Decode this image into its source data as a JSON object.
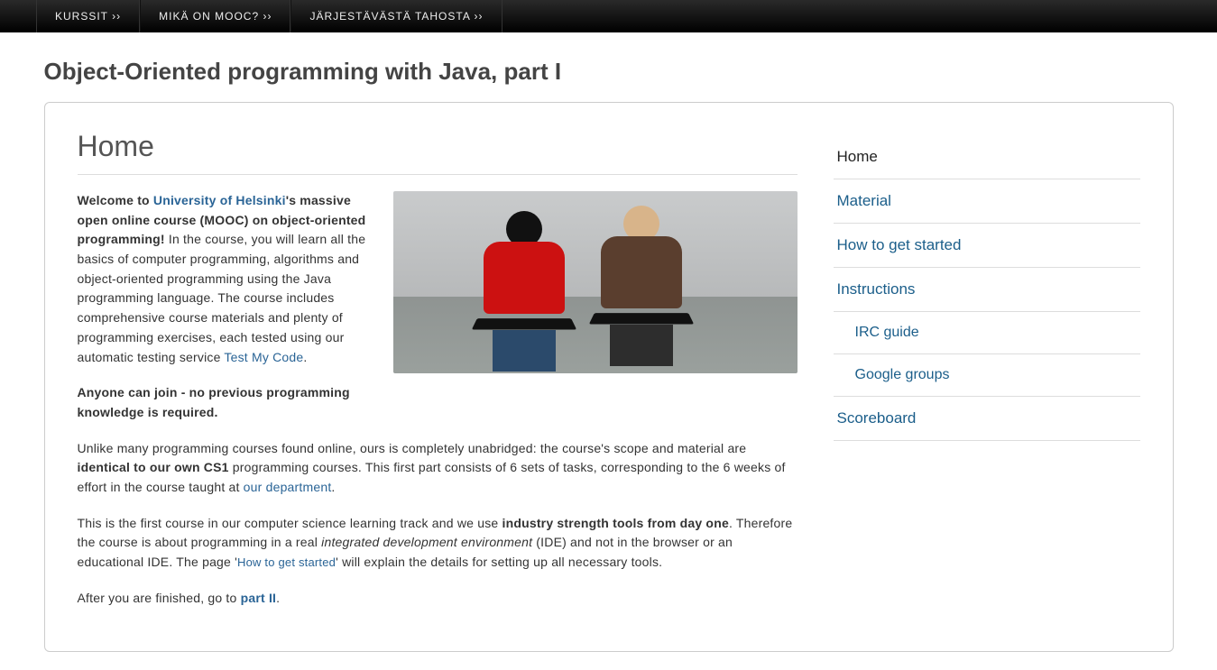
{
  "topbar": {
    "items": [
      {
        "label": "KURSSIT ››"
      },
      {
        "label": "MIKÄ ON MOOC? ››"
      },
      {
        "label": "JÄRJESTÄVÄSTÄ TAHOSTA ››"
      }
    ]
  },
  "page_title": "Object-Oriented programming with Java, part I",
  "main": {
    "heading": "Home",
    "p1": {
      "lead_a": "Welcome to ",
      "uni_link": "University of Helsinki",
      "lead_b": "'s massive open online course (MOOC) on object-oriented programming!",
      "body": " In the course, you will learn all the basics of computer programming, algorithms and object-oriented programming using the Java programming language. The course includes comprehensive course materials and plenty of programming exercises, each tested using our automatic testing service ",
      "tmc_link": "Test My Code",
      "tail": "."
    },
    "p2": "Anyone can join  -  no previous programming knowledge is required.",
    "p3": {
      "a": "Unlike many programming courses found online, ours is completely unabridged: the course's scope and material are ",
      "b": "identical to our own CS1",
      "c": " programming courses. This first part consists of 6 sets of tasks, corresponding to the 6 weeks of effort in the course taught at ",
      "dept_link": "our department",
      "d": "."
    },
    "p4": {
      "a": "This is the first course in our computer science learning track and we use ",
      "b": "industry strength tools from day one",
      "c": ". Therefore the course is about programming in a real ",
      "d": "integrated development environment",
      "e": " (IDE) and not in the browser or an educational IDE. The page '",
      "how_link": "How to get started",
      "f": "' will explain the details for setting up all necessary tools."
    },
    "p5": {
      "a": "After you are finished, go to ",
      "part2_link": "part II",
      "b": "."
    }
  },
  "sidebar": {
    "items": [
      {
        "label": "Home",
        "active": true,
        "sub": false
      },
      {
        "label": "Material",
        "active": false,
        "sub": false
      },
      {
        "label": "How to get started",
        "active": false,
        "sub": false
      },
      {
        "label": "Instructions",
        "active": false,
        "sub": false
      },
      {
        "label": "IRC guide",
        "active": false,
        "sub": true
      },
      {
        "label": "Google groups",
        "active": false,
        "sub": true
      },
      {
        "label": "Scoreboard",
        "active": false,
        "sub": false
      }
    ]
  }
}
